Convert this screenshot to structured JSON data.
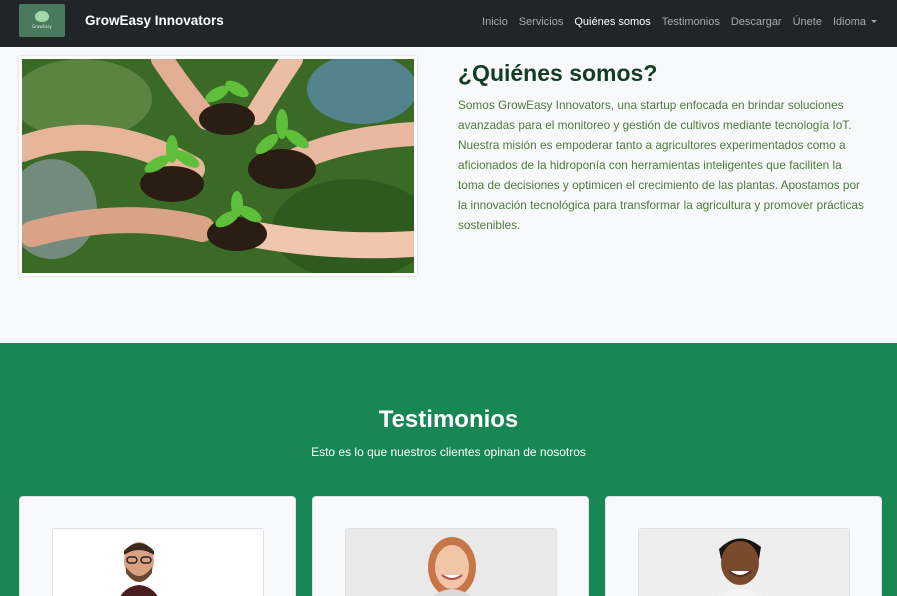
{
  "navbar": {
    "logo_text": "GrowEasy",
    "brand": "GrowEasy Innovators",
    "links": [
      {
        "label": "Inicio"
      },
      {
        "label": "Servicios"
      },
      {
        "label": "Quiénes somos"
      },
      {
        "label": "Testimonios"
      },
      {
        "label": "Descargar"
      },
      {
        "label": "Únete"
      },
      {
        "label": "Idioma"
      }
    ]
  },
  "about": {
    "title": "¿Quiénes somos?",
    "text": "Somos GrowEasy Innovators, una startup enfocada en brindar soluciones avanzadas para el monitoreo y gestión de cultivos mediante tecnología IoT. Nuestra misión es empoderar tanto a agricultores experimentados como a aficionados de la hidroponía con herramientas inteligentes que faciliten la toma de decisiones y optimicen el crecimiento de las plantas. Apostamos por la innovación tecnológica para transformar la agricultura y promover prácticas sostenibles."
  },
  "testimonials": {
    "title": "Testimonios",
    "subtitle": "Esto es lo que nuestros clientes opinan de nosotros"
  },
  "colors": {
    "navbar_bg": "#212529",
    "accent_green": "#198754",
    "title_green": "#123d24",
    "text_green": "#4c7a3c"
  }
}
